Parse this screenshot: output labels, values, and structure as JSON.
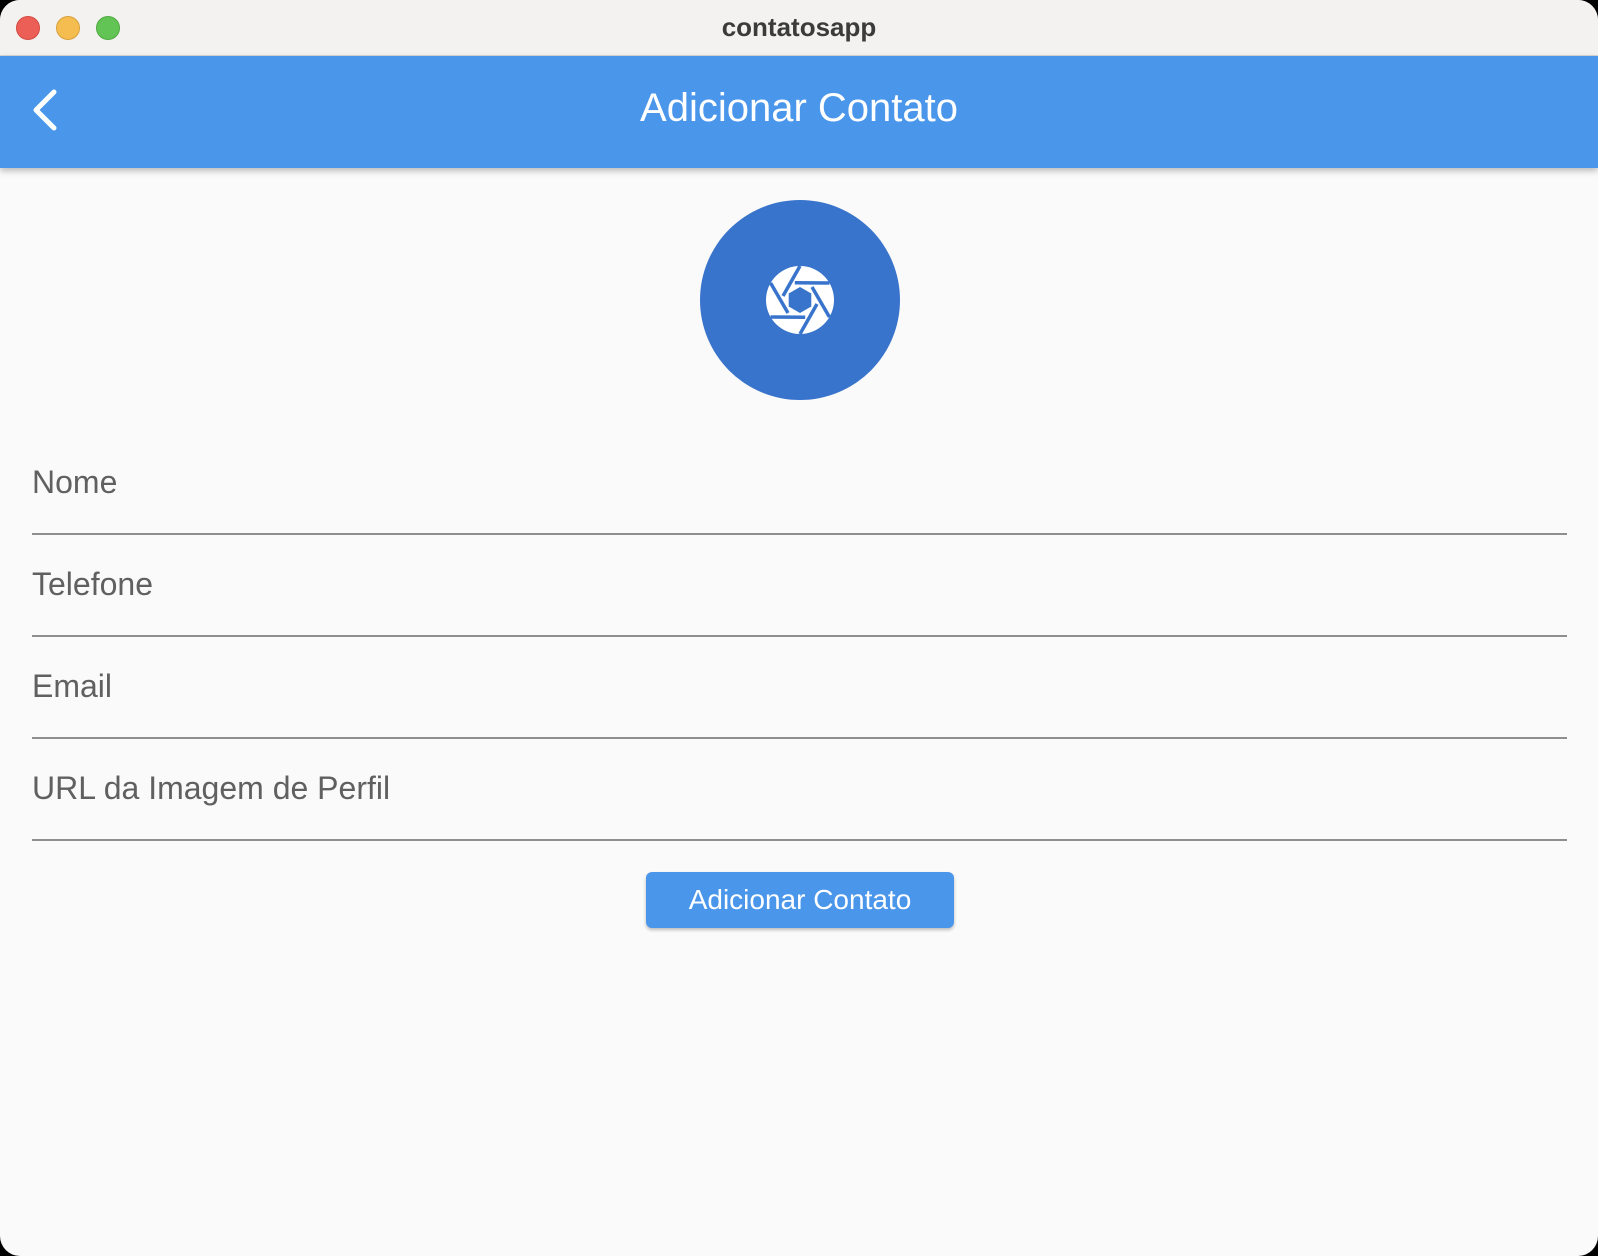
{
  "window": {
    "title": "contatosapp"
  },
  "appbar": {
    "title": "Adicionar Contato",
    "back_icon": "chevron-left-icon",
    "color": "#4a96eb"
  },
  "avatar": {
    "icon": "camera-aperture-icon",
    "color": "#3874cc"
  },
  "form": {
    "fields": [
      {
        "label": "Nome",
        "value": ""
      },
      {
        "label": "Telefone",
        "value": ""
      },
      {
        "label": "Email",
        "value": ""
      },
      {
        "label": "URL da Imagem de Perfil",
        "value": ""
      }
    ],
    "submit_label": "Adicionar Contato"
  }
}
